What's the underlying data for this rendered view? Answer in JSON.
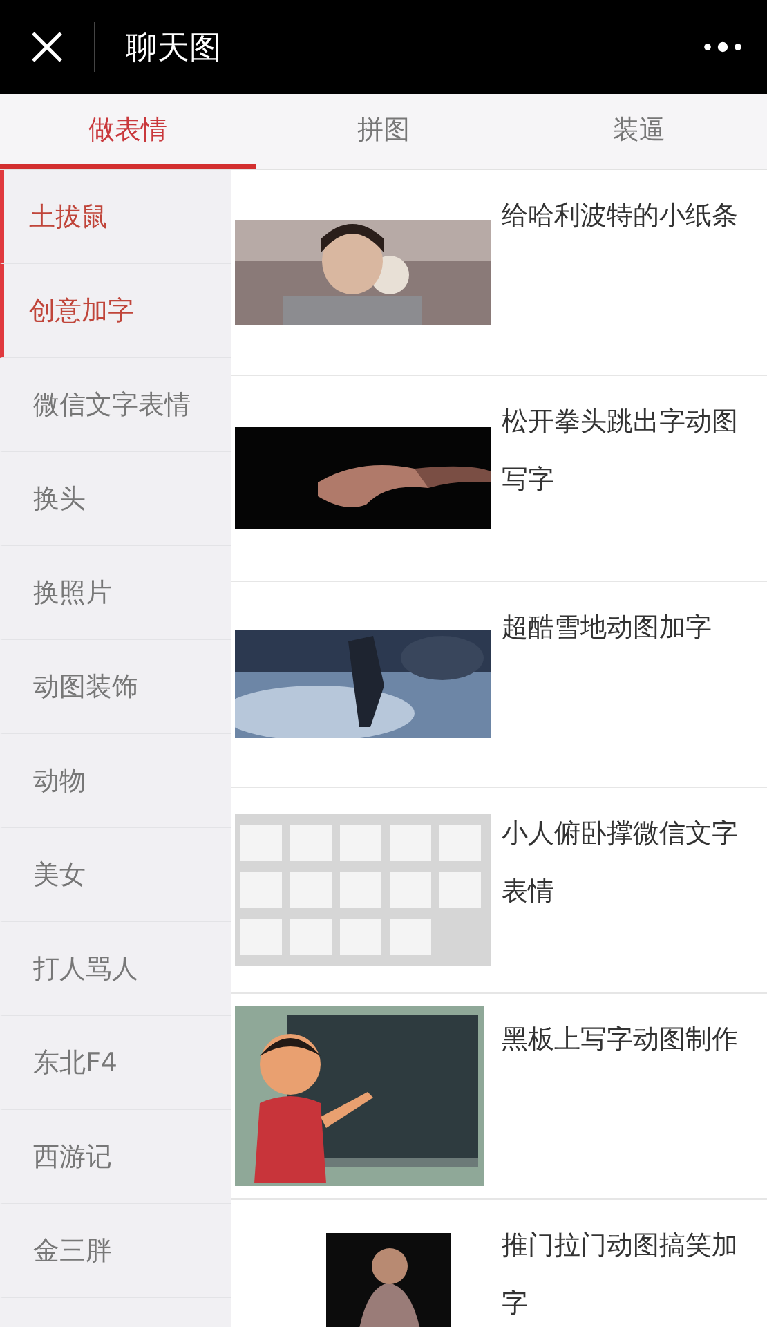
{
  "header": {
    "title": "聊天图"
  },
  "tabs": [
    {
      "label": "做表情",
      "selected": true
    },
    {
      "label": "拼图",
      "selected": false
    },
    {
      "label": "装逼",
      "selected": false
    }
  ],
  "sidebar": {
    "items": [
      {
        "label": "土拔鼠",
        "selected": true
      },
      {
        "label": "创意加字",
        "selected": true
      },
      {
        "label": "微信文字表情",
        "selected": false
      },
      {
        "label": "换头",
        "selected": false
      },
      {
        "label": "换照片",
        "selected": false
      },
      {
        "label": "动图装饰",
        "selected": false
      },
      {
        "label": "动物",
        "selected": false
      },
      {
        "label": "美女",
        "selected": false
      },
      {
        "label": "打人骂人",
        "selected": false
      },
      {
        "label": "东北F4",
        "selected": false
      },
      {
        "label": "西游记",
        "selected": false
      },
      {
        "label": "金三胖",
        "selected": false
      }
    ]
  },
  "templates": [
    {
      "title": "给哈利波特的小纸条"
    },
    {
      "title": "松开拳头跳出字动图写字"
    },
    {
      "title": "超酷雪地动图加字"
    },
    {
      "title": "小人俯卧撑微信文字表情"
    },
    {
      "title": "黑板上写字动图制作"
    },
    {
      "title": "推门拉门动图搞笑加字"
    }
  ]
}
